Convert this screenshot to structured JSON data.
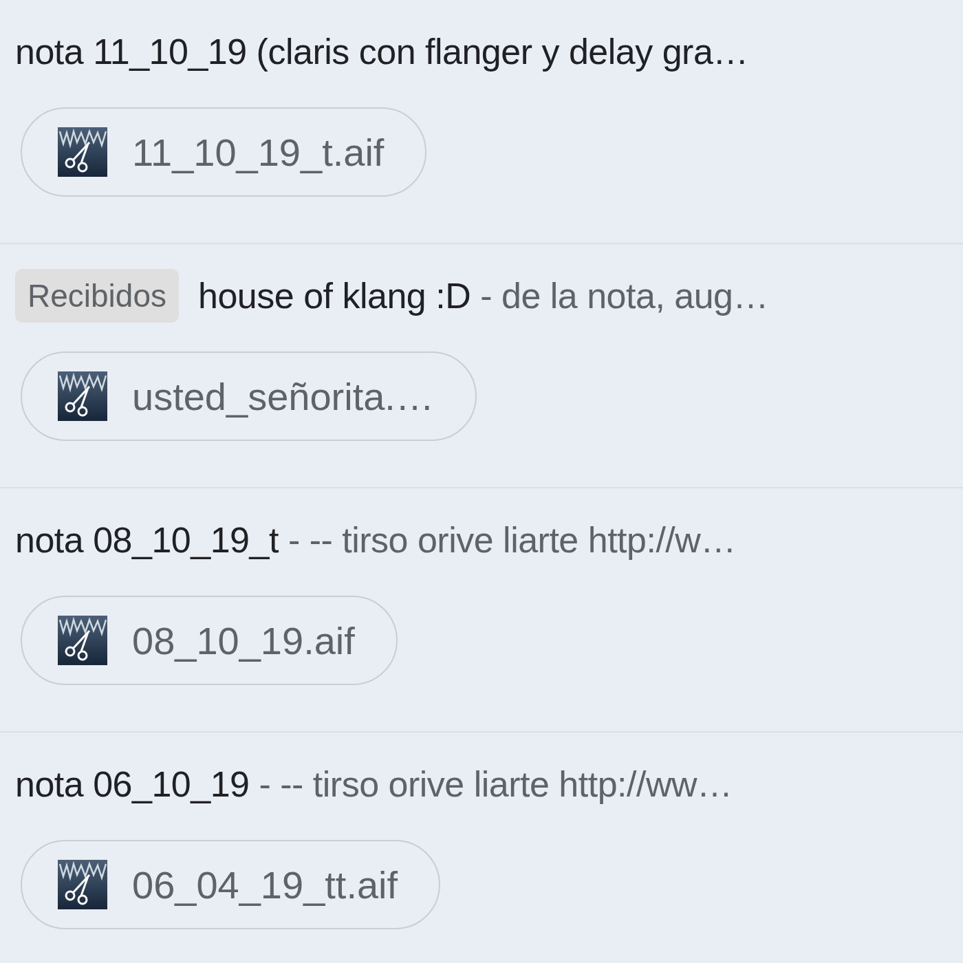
{
  "messages": [
    {
      "subject": "nota 11_10_19 (claris con flanger y delay gra…",
      "attachment": "11_10_19_t.aif"
    },
    {
      "label": "Recibidos",
      "subject": "house of klang :D",
      "snippet": "- de la nota, aug…",
      "attachment": "usted_señorita.…"
    },
    {
      "subject": "nota 08_10_19_t",
      "snippet": "- -- tirso orive liarte http://w…",
      "attachment": "08_10_19.aif"
    },
    {
      "subject": "nota 06_10_19",
      "snippet": "- -- tirso orive liarte http://ww…",
      "attachment": "06_04_19_tt.aif"
    }
  ]
}
